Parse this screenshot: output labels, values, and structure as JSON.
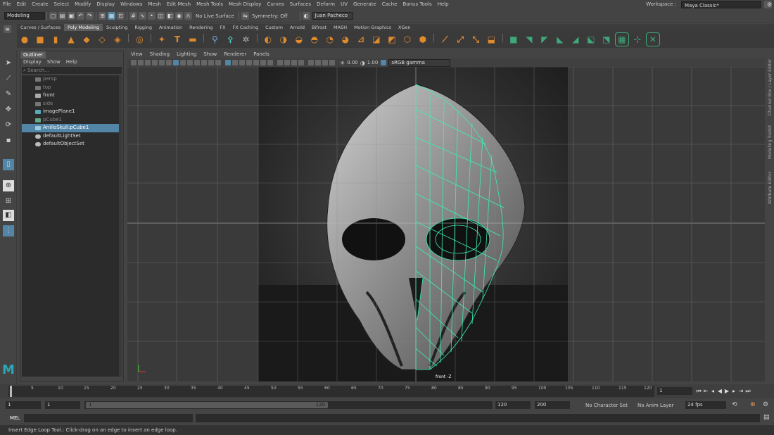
{
  "menubar": {
    "items": [
      "File",
      "Edit",
      "Create",
      "Select",
      "Modify",
      "Display",
      "Windows",
      "Mesh",
      "Edit Mesh",
      "Mesh Tools",
      "Mesh Display",
      "Curves",
      "Surfaces",
      "Deform",
      "UV",
      "Generate",
      "Cache",
      "Bonus Tools",
      "Help"
    ],
    "workspace_label": "Workspace :",
    "workspace_value": "Maya Classic*"
  },
  "statusline": {
    "menuset": "Modeling",
    "live_surface": "No Live Surface",
    "symmetry": "Symmetry: Off",
    "user": "Juan Pacheco"
  },
  "shelf_tabs": {
    "tabs": [
      "Curves / Surfaces",
      "Poly Modeling",
      "Sculpting",
      "Rigging",
      "Animation",
      "Rendering",
      "FX",
      "FX Caching",
      "Custom",
      "Arnold",
      "Bifrost",
      "MASH",
      "Motion Graphics",
      "XGen"
    ],
    "active": "Poly Modeling"
  },
  "outliner": {
    "title": "Outliner",
    "menus": [
      "Display",
      "Show",
      "Help"
    ],
    "search_placeholder": "Search...",
    "items": [
      {
        "label": "persp",
        "dim": true,
        "type": "camera"
      },
      {
        "label": "top",
        "dim": true,
        "type": "camera"
      },
      {
        "label": "front",
        "dim": false,
        "type": "camera"
      },
      {
        "label": "side",
        "dim": true,
        "type": "camera"
      },
      {
        "label": "imagePlane1",
        "dim": false,
        "type": "image"
      },
      {
        "label": "pCube1",
        "dim": true,
        "type": "mesh"
      },
      {
        "label": "AnilloSkull:pCube1",
        "dim": false,
        "type": "mesh",
        "selected": true
      },
      {
        "label": "defaultLightSet",
        "dim": false,
        "type": "set"
      },
      {
        "label": "defaultObjectSet",
        "dim": false,
        "type": "set"
      }
    ]
  },
  "viewport": {
    "menus": [
      "View",
      "Shading",
      "Lighting",
      "Show",
      "Renderer",
      "Panels"
    ],
    "exposure": "0.00",
    "gamma": "1.00",
    "colorspace": "sRGB gamma",
    "camera_label": "front -Z"
  },
  "right_tabs": [
    "Channel Box / Layer Editor",
    "Modeling Toolkit",
    "Attribute Editor"
  ],
  "timeline": {
    "ticks": [
      "1",
      "5",
      "10",
      "15",
      "20",
      "25",
      "30",
      "35",
      "40",
      "45",
      "50",
      "55",
      "60",
      "65",
      "70",
      "75",
      "80",
      "85",
      "90",
      "95",
      "100",
      "105",
      "110",
      "115",
      "120"
    ],
    "current_frame": "1"
  },
  "range": {
    "start": "1",
    "start_inner": "1",
    "slider_start": "1",
    "slider_end": "120",
    "end_inner": "120",
    "end": "200",
    "character_set": "No Character Set",
    "anim_layer": "No Anim Layer",
    "fps": "24 fps"
  },
  "cmdline": {
    "lang": "MEL"
  },
  "helpline": "Insert Edge Loop Tool.: Click-drag on an edge to insert an edge loop.",
  "colors": {
    "accent": "#5285a6",
    "wire": "#3cf0b0",
    "shelf_orange": "#e08a2c",
    "shelf_green": "#3fa77a"
  }
}
